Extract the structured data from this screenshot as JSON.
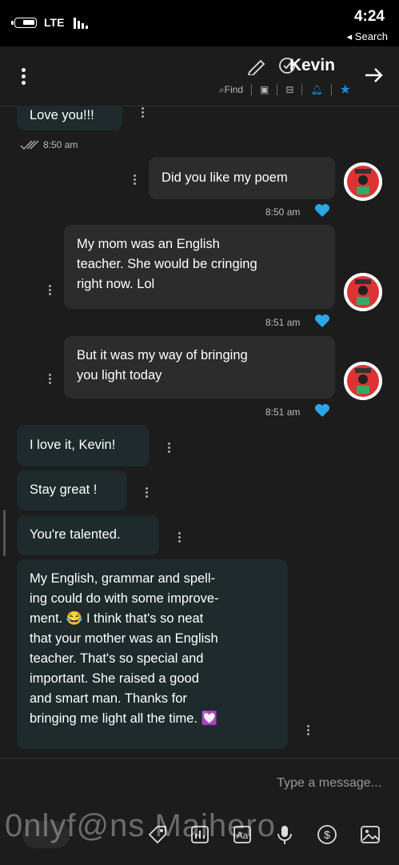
{
  "status": {
    "network": "LTE",
    "time": "4:24",
    "back_label": "Search"
  },
  "header": {
    "contact_name": "Kevin",
    "find_label": "Find"
  },
  "messages": {
    "m0": {
      "text": "Love you!!!",
      "time": "8:50 am"
    },
    "m1": {
      "text": "Did you like my poem",
      "time": "8:50 am"
    },
    "m2": {
      "text": "My mom was an English\nteacher. She would be cringing\nright now. Lol",
      "time": "8:51 am"
    },
    "m3": {
      "text": "But it was my way of bringing\nyou light today",
      "time": "8:51 am"
    },
    "m4": {
      "text": "I love it, Kevin!"
    },
    "m5": {
      "text": "Stay great !"
    },
    "m6": {
      "text": "You're talented."
    },
    "m7": {
      "text": "My English, grammar and spell-\ning could do with some improve-\nment. 😂 I think that's so neat\nthat your mother was an English\nteacher. That's so special and\nimportant. She raised a good\nand smart man. Thanks for\nbringing me light all the time. 💟"
    }
  },
  "input": {
    "placeholder": "Type a message..."
  },
  "watermark": "0nlyf@ns Maihero",
  "colors": {
    "accent": "#1a8cd8",
    "heart": "#29a8e8",
    "incoming_bubble": "#1e2a2c",
    "outgoing_bubble": "#2c2c2c"
  }
}
